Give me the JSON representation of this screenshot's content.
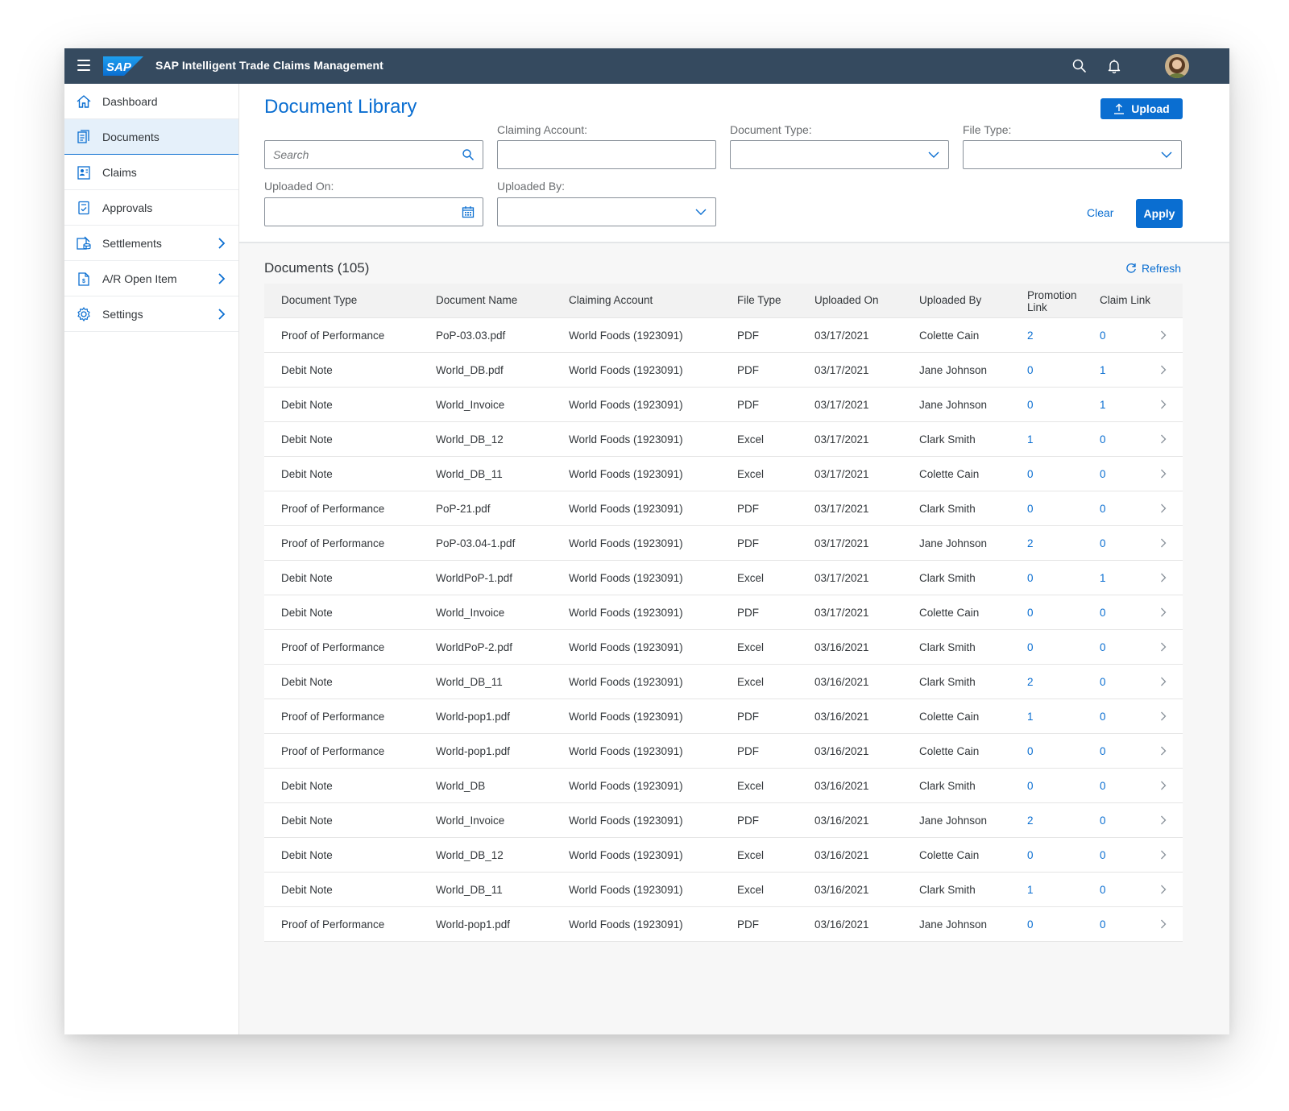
{
  "shell": {
    "logo_text": "SAP",
    "app_title": "SAP Intelligent Trade Claims Management",
    "icons": [
      "menu-icon",
      "search-icon",
      "bell-icon",
      "user-avatar"
    ]
  },
  "sidebar": {
    "items": [
      {
        "label": "Dashboard",
        "icon": "home-icon",
        "active": false,
        "expandable": false
      },
      {
        "label": "Documents",
        "icon": "documents-icon",
        "active": true,
        "expandable": false
      },
      {
        "label": "Claims",
        "icon": "claims-icon",
        "active": false,
        "expandable": false
      },
      {
        "label": "Approvals",
        "icon": "approvals-icon",
        "active": false,
        "expandable": false
      },
      {
        "label": "Settlements",
        "icon": "settlements-icon",
        "active": false,
        "expandable": true
      },
      {
        "label": "A/R Open Item",
        "icon": "ar-open-item-icon",
        "active": false,
        "expandable": true
      },
      {
        "label": "Settings",
        "icon": "gear-icon",
        "active": false,
        "expandable": true
      }
    ]
  },
  "filters": {
    "page_title": "Document Library",
    "upload_label": "Upload",
    "search_placeholder": "Search",
    "claiming_account_label": "Claiming Account:",
    "document_type_label": "Document Type:",
    "file_type_label": "File Type:",
    "uploaded_on_label": "Uploaded On:",
    "uploaded_by_label": "Uploaded By:",
    "clear_label": "Clear",
    "apply_label": "Apply"
  },
  "documents": {
    "count_title": "Documents (105)",
    "refresh_label": "Refresh",
    "columns": [
      "Document Type",
      "Document Name",
      "Claiming Account",
      "File Type",
      "Uploaded On",
      "Uploaded By",
      "Promotion Link",
      "Claim Link"
    ],
    "rows": [
      [
        "Proof of Performance",
        "PoP-03.03.pdf",
        "World Foods (1923091)",
        "PDF",
        "03/17/2021",
        "Colette Cain",
        "2",
        "0"
      ],
      [
        "Debit Note",
        "World_DB.pdf",
        "World Foods (1923091)",
        "PDF",
        "03/17/2021",
        "Jane Johnson",
        "0",
        "1"
      ],
      [
        "Debit Note",
        "World_Invoice",
        "World Foods (1923091)",
        "PDF",
        "03/17/2021",
        "Jane Johnson",
        "0",
        "1"
      ],
      [
        "Debit Note",
        "World_DB_12",
        "World Foods (1923091)",
        "Excel",
        "03/17/2021",
        "Clark Smith",
        "1",
        "0"
      ],
      [
        "Debit Note",
        "World_DB_11",
        "World Foods (1923091)",
        "Excel",
        "03/17/2021",
        "Colette Cain",
        "0",
        "0"
      ],
      [
        "Proof of Performance",
        "PoP-21.pdf",
        "World Foods (1923091)",
        "PDF",
        "03/17/2021",
        "Clark Smith",
        "0",
        "0"
      ],
      [
        "Proof of Performance",
        "PoP-03.04-1.pdf",
        "World Foods (1923091)",
        "PDF",
        "03/17/2021",
        "Jane Johnson",
        "2",
        "0"
      ],
      [
        "Debit Note",
        "WorldPoP-1.pdf",
        "World Foods (1923091)",
        "Excel",
        "03/17/2021",
        "Clark Smith",
        "0",
        "1"
      ],
      [
        "Debit Note",
        "World_Invoice",
        "World Foods (1923091)",
        "PDF",
        "03/17/2021",
        "Colette Cain",
        "0",
        "0"
      ],
      [
        "Proof of Performance",
        "WorldPoP-2.pdf",
        "World Foods (1923091)",
        "Excel",
        "03/16/2021",
        "Clark Smith",
        "0",
        "0"
      ],
      [
        "Debit Note",
        "World_DB_11",
        "World Foods (1923091)",
        "Excel",
        "03/16/2021",
        "Clark Smith",
        "2",
        "0"
      ],
      [
        "Proof of Performance",
        "World-pop1.pdf",
        "World Foods (1923091)",
        "PDF",
        "03/16/2021",
        "Colette Cain",
        "1",
        "0"
      ],
      [
        "Proof of Performance",
        "World-pop1.pdf",
        "World Foods (1923091)",
        "PDF",
        "03/16/2021",
        "Colette Cain",
        "0",
        "0"
      ],
      [
        "Debit Note",
        "World_DB",
        "World Foods (1923091)",
        "Excel",
        "03/16/2021",
        "Clark Smith",
        "0",
        "0"
      ],
      [
        "Debit Note",
        "World_Invoice",
        "World Foods (1923091)",
        "PDF",
        "03/16/2021",
        "Jane Johnson",
        "2",
        "0"
      ],
      [
        "Debit Note",
        "World_DB_12",
        "World Foods (1923091)",
        "Excel",
        "03/16/2021",
        "Colette Cain",
        "0",
        "0"
      ],
      [
        "Debit Note",
        "World_DB_11",
        "World Foods (1923091)",
        "Excel",
        "03/16/2021",
        "Clark Smith",
        "1",
        "0"
      ],
      [
        "Proof of Performance",
        "World-pop1.pdf",
        "World Foods (1923091)",
        "PDF",
        "03/16/2021",
        "Jane Johnson",
        "0",
        "0"
      ]
    ]
  },
  "colors": {
    "shell_bg": "#354a5f",
    "accent": "#0a6ed1",
    "active_nav_bg": "#e5f0fa",
    "content_bg": "#f7f7f7"
  }
}
